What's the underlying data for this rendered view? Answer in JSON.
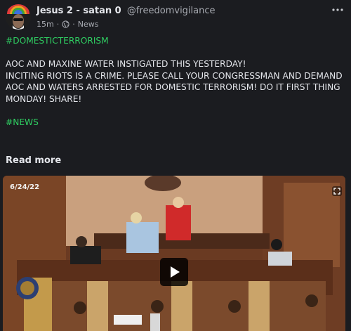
{
  "author": {
    "name": "Jesus 2 - satan 0",
    "handle": "@freedomvigilance"
  },
  "meta": {
    "time": "15m",
    "separator": "·",
    "category": "News"
  },
  "post": {
    "hashtag1": "#DOMESTICTERRORISM",
    "line1": "AOC AND MAXINE WATER INSTIGATED THIS YESTERDAY!",
    "line2": "INCITING RIOTS IS A CRIME. PLEASE CALL YOUR CONGRESSMAN AND DEMAND AOC AND WATERS ARRESTED FOR DOMESTIC TERRORISM! DO IT FIRST THING MONDAY! SHARE!",
    "hashtag2": "#NEWS"
  },
  "read_more": "Read more",
  "video": {
    "date": "6/24/22"
  },
  "colors": {
    "background": "#1b1c20",
    "hashtag": "#2fcf62",
    "text": "#e4e6eb",
    "muted": "#a8abb2"
  },
  "icons": [
    "more-options-icon",
    "globe-icon",
    "play-icon",
    "fullscreen-icon"
  ]
}
